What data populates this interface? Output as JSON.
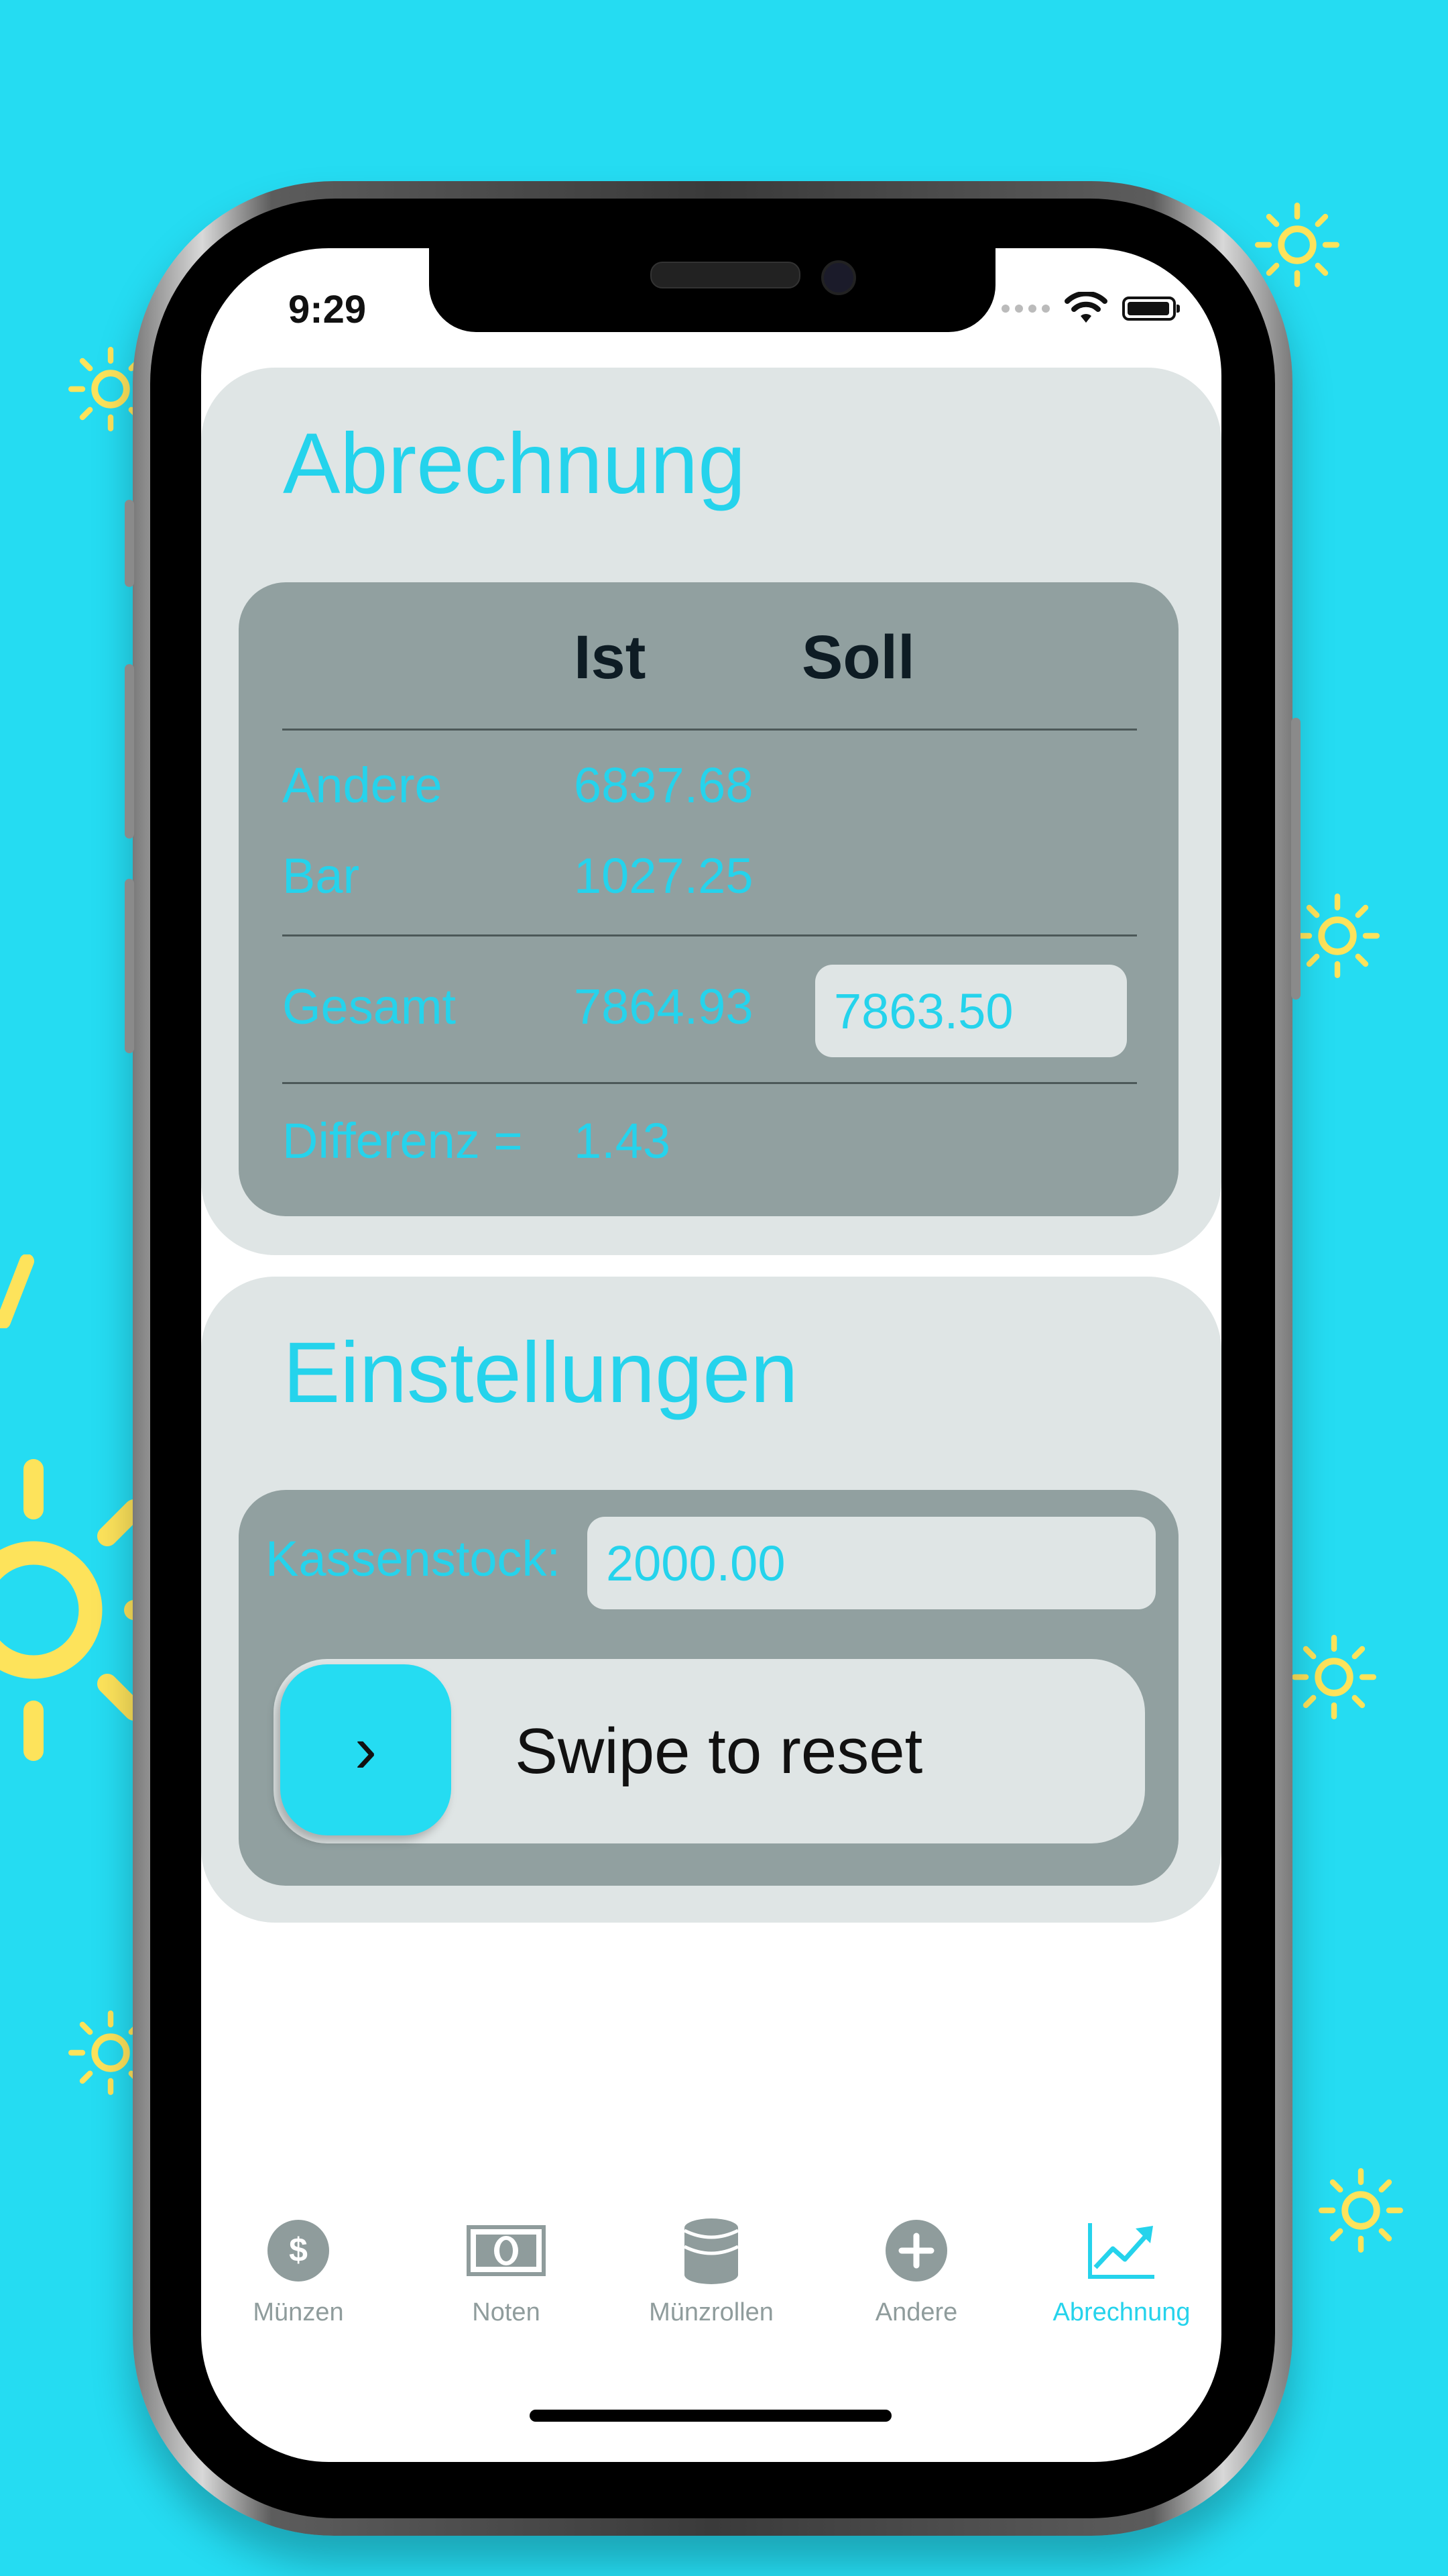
{
  "status_bar": {
    "time": "9:29"
  },
  "abrechnung": {
    "title": "Abrechnung",
    "headers": {
      "ist": "Ist",
      "soll": "Soll"
    },
    "rows": [
      {
        "label": "Andere",
        "ist": "6837.68"
      },
      {
        "label": "Bar",
        "ist": "1027.25"
      }
    ],
    "gesamt": {
      "label": "Gesamt",
      "ist": "7864.93",
      "soll": "7863.50"
    },
    "differenz": {
      "label": "Differenz =",
      "value": "1.43"
    }
  },
  "einstellungen": {
    "title": "Einstellungen",
    "kassenstock_label": "Kassenstock:",
    "kassenstock_value": "2000.00",
    "swipe_label": "Swipe to reset",
    "swipe_knob_glyph": "›"
  },
  "tabbar": {
    "items": [
      {
        "label": "Münzen",
        "icon": "dollar-coin-icon"
      },
      {
        "label": "Noten",
        "icon": "banknote-icon"
      },
      {
        "label": "Münzrollen",
        "icon": "coin-roll-icon"
      },
      {
        "label": "Andere",
        "icon": "plus-circle-icon"
      },
      {
        "label": "Abrechnung",
        "icon": "chart-trend-icon",
        "active": true
      }
    ]
  },
  "colors": {
    "accent": "#25DCF2",
    "card": "#DFE5E5",
    "panel": "#91A0A0",
    "sun": "#FDE35B"
  }
}
